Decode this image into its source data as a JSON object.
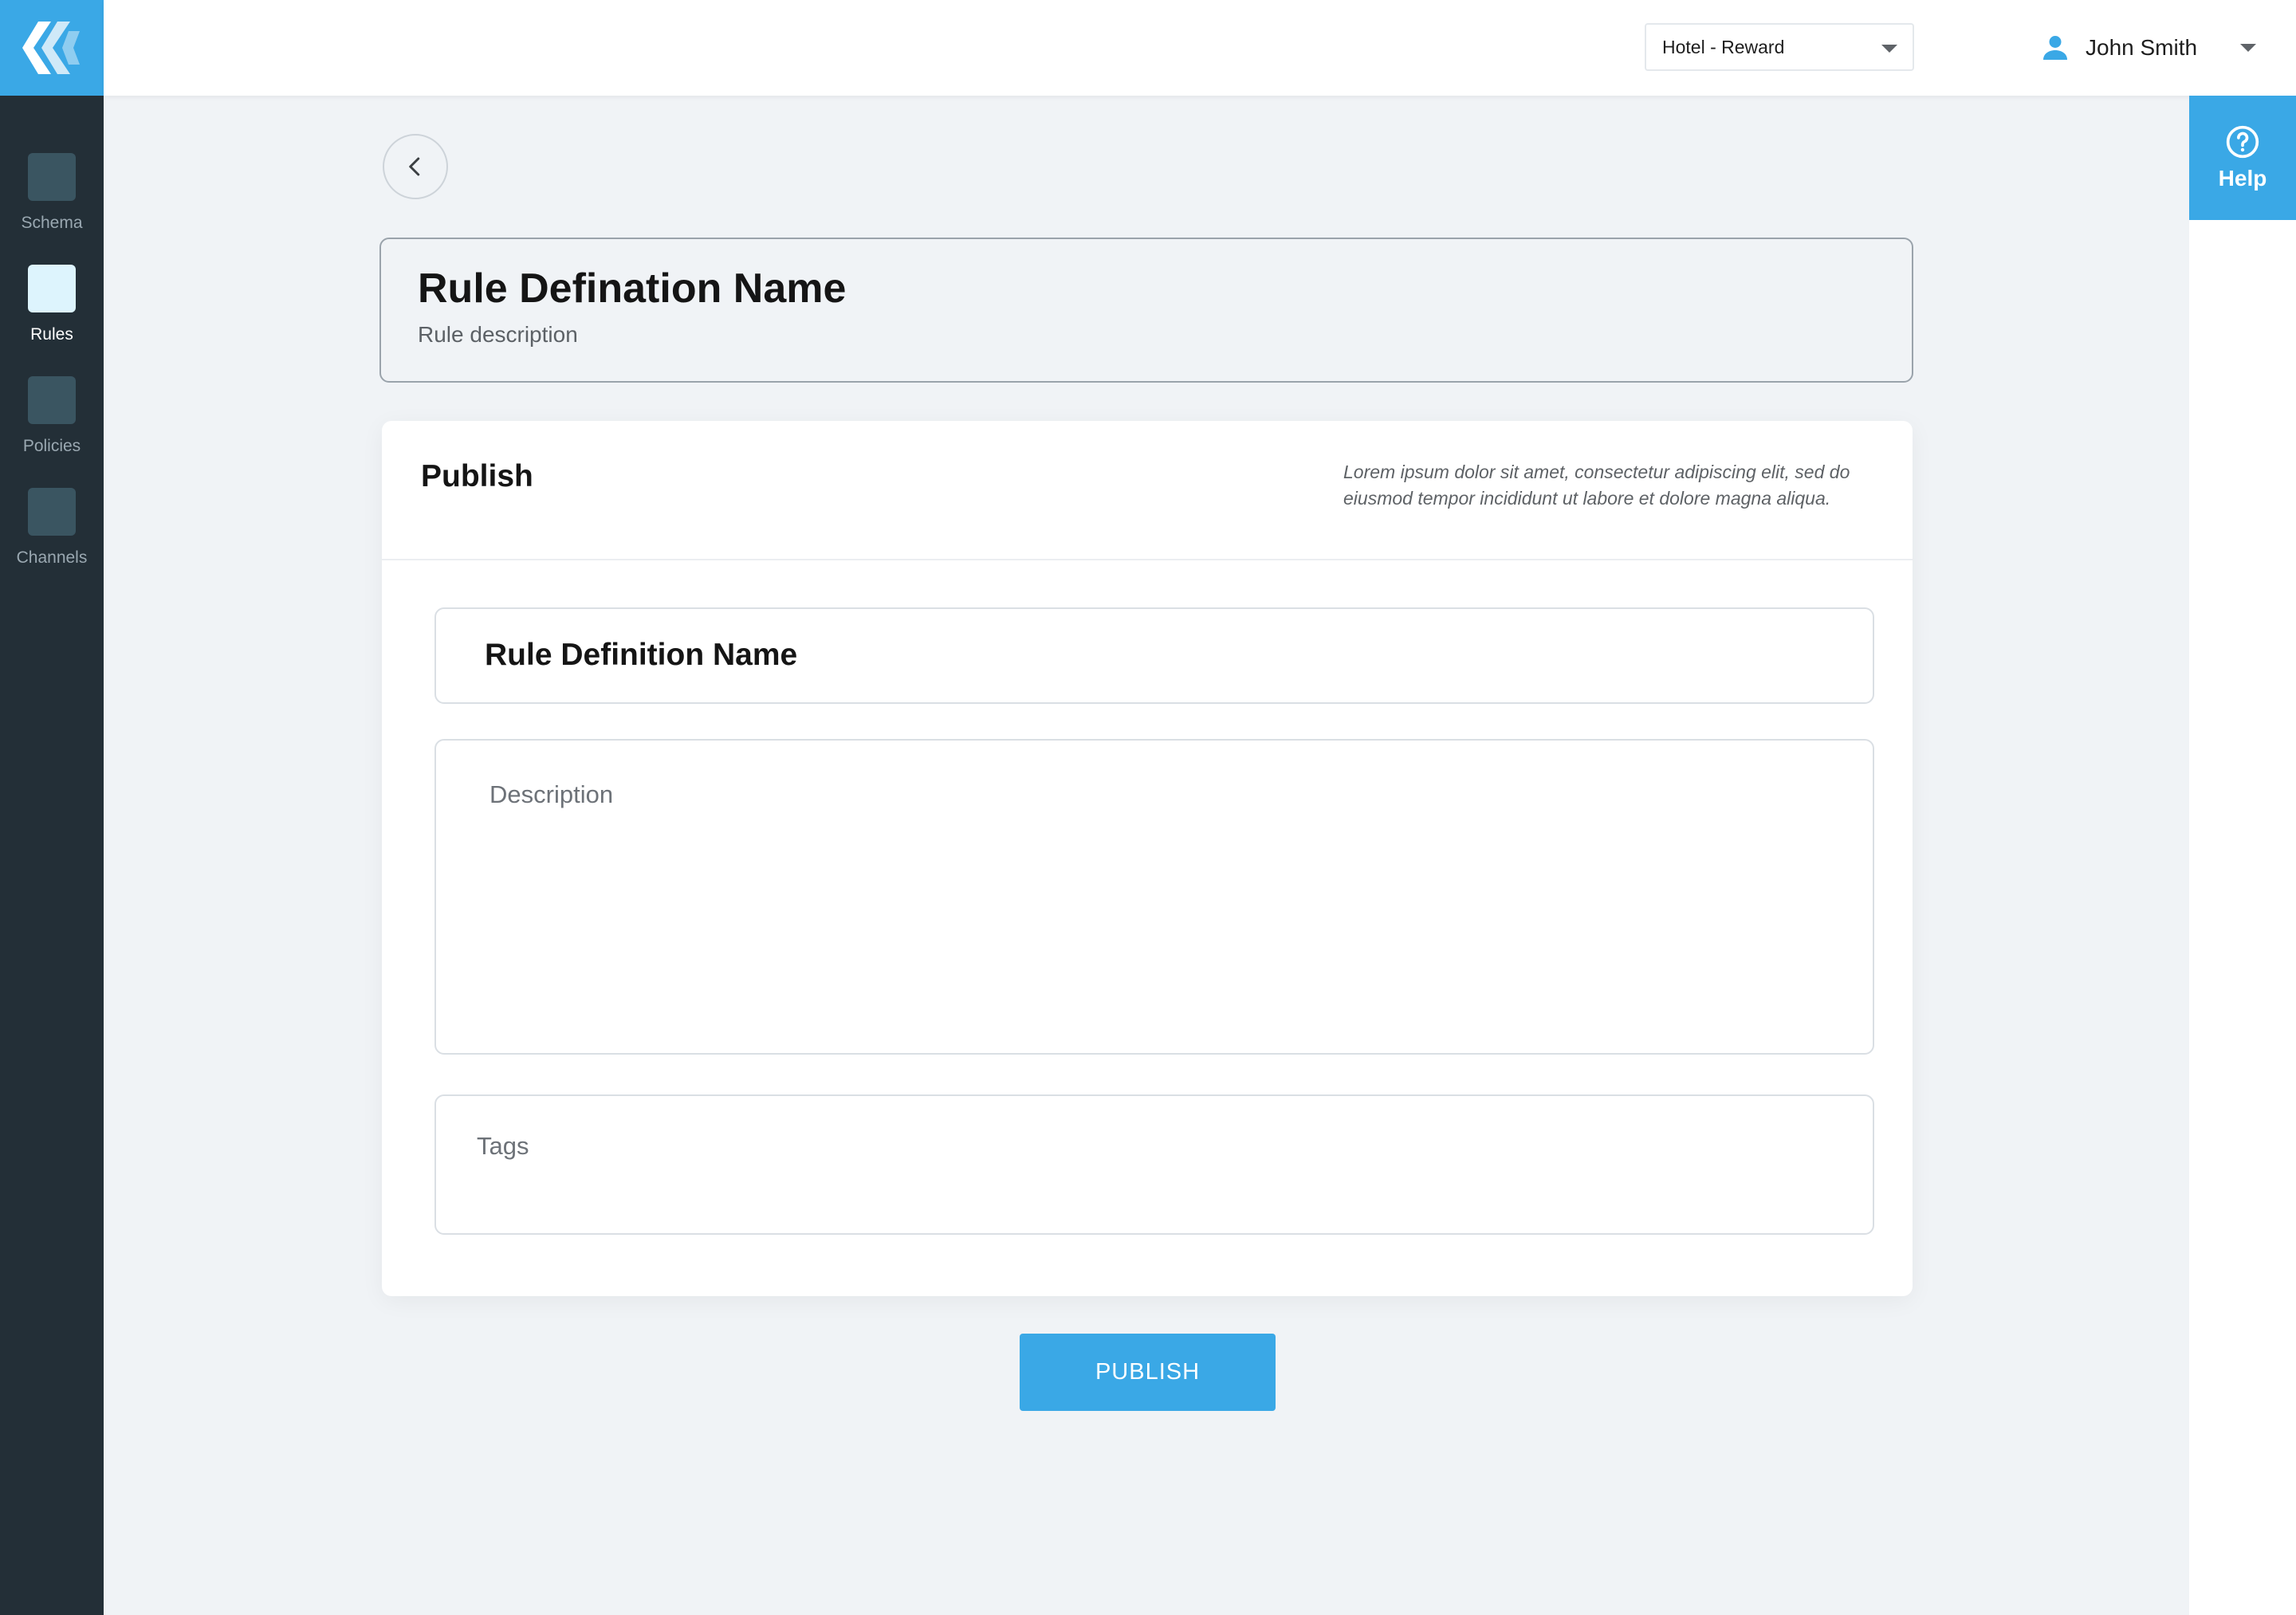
{
  "colors": {
    "accent": "#3AA8E6",
    "sidebar_bg": "#232F37",
    "page_bg": "#F0F3F6",
    "nav_active_icon": "#DDF4FD",
    "nav_inactive_icon": "#3A5561"
  },
  "sidebar": {
    "logo_icon": "brand-chevron-logo",
    "items": [
      {
        "label": "Schema",
        "active": false
      },
      {
        "label": "Rules",
        "active": true
      },
      {
        "label": "Policies",
        "active": false
      },
      {
        "label": "Channels",
        "active": false
      }
    ]
  },
  "topbar": {
    "project_select": {
      "value": "Hotel - Reward"
    },
    "user": {
      "name": "John Smith",
      "icon": "user-icon"
    }
  },
  "help": {
    "label": "Help",
    "icon": "question-circle-icon"
  },
  "back_button": {
    "icon": "chevron-left-icon"
  },
  "rule_header": {
    "title": "Rule Defination Name",
    "description": "Rule description"
  },
  "publish_card": {
    "title": "Publish",
    "note_line1": "Lorem ipsum dolor sit amet, consectetur adipiscing elit, sed do",
    "note_line2": "eiusmod tempor incididunt ut labore et dolore magna aliqua.",
    "name_field_value": "Rule Definition Name",
    "description_placeholder": "Description",
    "tags_placeholder": "Tags"
  },
  "publish_button": {
    "label": "PUBLISH"
  }
}
